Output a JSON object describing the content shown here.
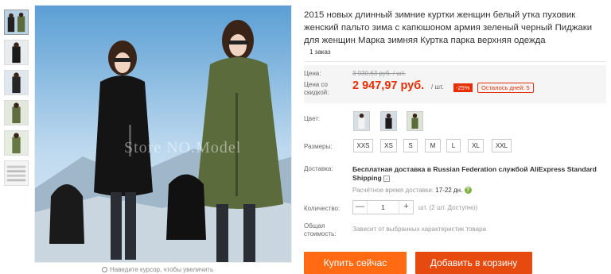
{
  "product": {
    "title": "2015 новых длинный зимние куртки женщин белый утка пуховик женский пальто зима с капюшоном армия зеленый черный Пиджаки для женщин Марка зимняя Куртка парка верхняя одежда",
    "orders": "1 заказ",
    "watermark": "Store NO.Model",
    "zoom_hint": "Наведите курсор, чтобы увеличить"
  },
  "thumbnails": [
    {
      "icon": "product-photo-1"
    },
    {
      "icon": "product-photo-2"
    },
    {
      "icon": "product-photo-3"
    },
    {
      "icon": "product-photo-4"
    },
    {
      "icon": "product-photo-5"
    },
    {
      "icon": "product-photo-6"
    }
  ],
  "price": {
    "label": "Цена:",
    "old_value": "3 930,63 руб. / шт.",
    "discount_label": "Цена со скидкой:",
    "new_value": "2 947,97 руб.",
    "per_unit": "/ шт.",
    "discount": "-25%",
    "days_left": "Осталось дней: 5"
  },
  "color": {
    "label": "Цвет:",
    "options": [
      "coat-white",
      "coat-black",
      "coat-green"
    ]
  },
  "sizes": {
    "label": "Размеры:",
    "options": [
      "XXS",
      "XS",
      "S",
      "M",
      "L",
      "XL",
      "XXL"
    ]
  },
  "shipping": {
    "label": "Доставка:",
    "title": "Бесплатная доставка в Russian Federation службой AliExpress Standard Shipping",
    "time_label": "Расчётное время доставки:",
    "time_value": "17-22 дн.",
    "help": "?"
  },
  "quantity": {
    "label": "Количество:",
    "minus": "—",
    "value": "1",
    "plus": "+",
    "note": "шт. (2 шт. Доступно)"
  },
  "total": {
    "label_line1": "Общая",
    "label_line2": "стоимость:",
    "note": "Зависит от выбранных характеристик товара"
  },
  "buttons": {
    "buy": "Купить сейчас",
    "cart": "Добавить в корзину"
  },
  "colors": {
    "accent_red": "#e62e04",
    "buy_orange": "#ff6a13",
    "cart_orange": "#e64a0e",
    "help_green": "#7cb342"
  }
}
